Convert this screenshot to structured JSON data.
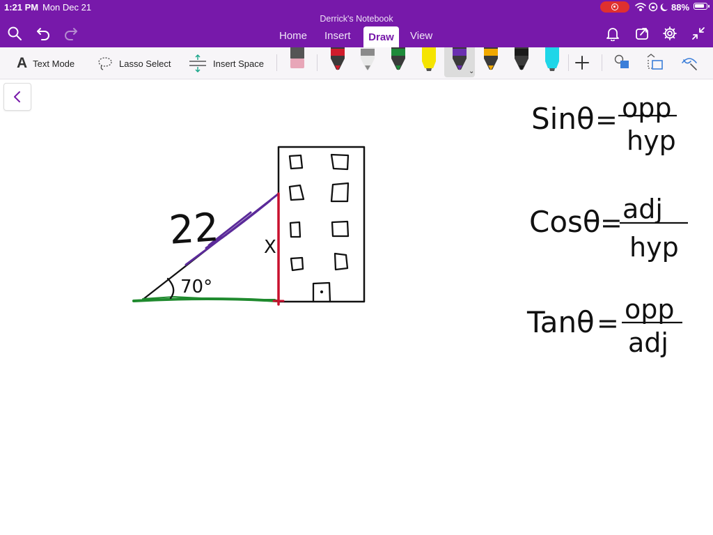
{
  "status_bar": {
    "time": "1:21 PM",
    "date": "Mon Dec 21",
    "battery": "88%",
    "battery_level": 0.88
  },
  "header": {
    "notebook_title": "Derrick's Notebook",
    "tabs": [
      {
        "label": "Home"
      },
      {
        "label": "Insert"
      },
      {
        "label": "Draw",
        "active": true
      },
      {
        "label": "View"
      }
    ],
    "left_icons": [
      "search-icon",
      "undo-icon",
      "redo-icon"
    ],
    "right_icons": [
      "bell-icon",
      "share-icon",
      "gear-icon",
      "collapse-icon"
    ]
  },
  "toolbar": {
    "text_mode": "Text Mode",
    "lasso_select": "Lasso Select",
    "insert_space": "Insert Space",
    "pens": [
      {
        "name": "eraser",
        "color": "#e8a6b8"
      },
      {
        "name": "red-pen",
        "color": "#d01c2c"
      },
      {
        "name": "gray-pencil",
        "color": "#8a8a8a"
      },
      {
        "name": "green-pen",
        "color": "#1e8a3a"
      },
      {
        "name": "yellow-highlighter",
        "color": "#f5e400"
      },
      {
        "name": "purple-pen",
        "color": "#6a2fb0",
        "selected": true
      },
      {
        "name": "orange-pen",
        "color": "#f0a800"
      },
      {
        "name": "black-pen",
        "color": "#1a1a1a"
      },
      {
        "name": "cyan-highlighter",
        "color": "#1fd6e8"
      }
    ],
    "colors": {
      "accent": "#7719aa",
      "shape_fill": "#3b7ed9"
    }
  },
  "canvas": {
    "hypotenuse_label": "22",
    "angle_label": "70°",
    "opposite_label": "X",
    "formulas": [
      {
        "name": "Sinθ",
        "numerator": "opp",
        "denominator": "hyp"
      },
      {
        "name": "Cosθ",
        "numerator": "adj",
        "denominator": "hyp"
      },
      {
        "name": "Tanθ",
        "numerator": "opp",
        "denominator": "adj"
      }
    ],
    "ink_colors": {
      "black": "#111111",
      "green": "#1f8a2e",
      "red": "#c8102e",
      "purple": "#5b2a9a"
    }
  }
}
